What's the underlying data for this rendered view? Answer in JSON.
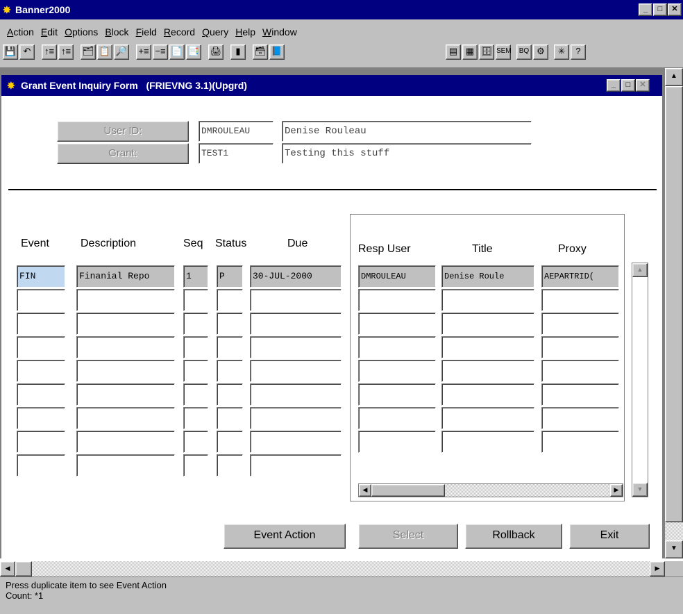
{
  "app": {
    "title": "Banner2000",
    "icon": "banner-logo-icon"
  },
  "menu": [
    "Action",
    "Edit",
    "Options",
    "Block",
    "Field",
    "Record",
    "Query",
    "Help",
    "Window"
  ],
  "toolbar": {
    "left": [
      {
        "name": "save-icon",
        "glyph": "💾"
      },
      {
        "name": "undo-icon",
        "glyph": "↶"
      },
      {
        "name": "previous-block-icon",
        "glyph": "↑≡"
      },
      {
        "name": "next-block-icon",
        "glyph": "↑≡"
      },
      {
        "name": "query-icon",
        "glyph": "🗂"
      },
      {
        "name": "list-icon",
        "glyph": "📋"
      },
      {
        "name": "search-icon",
        "glyph": "🔎"
      },
      {
        "name": "insert-record-icon",
        "glyph": "+≡"
      },
      {
        "name": "remove-record-icon",
        "glyph": "−≡"
      },
      {
        "name": "copy-icon",
        "glyph": "📄"
      },
      {
        "name": "paste-icon",
        "glyph": "📑"
      },
      {
        "name": "print-icon",
        "glyph": "🖨"
      },
      {
        "name": "chart-icon",
        "glyph": "▮"
      },
      {
        "name": "form-icon",
        "glyph": "🗃"
      },
      {
        "name": "help-book-icon",
        "glyph": "📘"
      }
    ],
    "right": [
      {
        "name": "calculator-icon",
        "glyph": "▤"
      },
      {
        "name": "calendar-icon",
        "glyph": "▦"
      },
      {
        "name": "organizer-icon",
        "glyph": "🗄"
      },
      {
        "name": "sem-icon",
        "glyph": "SEM"
      },
      {
        "name": "bq-icon",
        "glyph": "BQ"
      },
      {
        "name": "refresh-icon",
        "glyph": "⚙"
      },
      {
        "name": "options-icon",
        "glyph": "✳"
      },
      {
        "name": "help-icon",
        "glyph": "?"
      }
    ]
  },
  "form": {
    "title": "Grant Event Inquiry Form   (FRIEVNG 3.1)(Upgrd)",
    "user_label": "User ID:",
    "user_id": "DMROULEAU",
    "user_name": "Denise Rouleau",
    "grant_label": "Grant:",
    "grant_code": "TEST1",
    "grant_desc": "Testing this stuff"
  },
  "events": {
    "headers": {
      "event": "Event",
      "description": "Description",
      "seq": "Seq",
      "status": "Status",
      "due": "Due"
    },
    "rows": [
      {
        "event": "FIN",
        "description": "Finanial Repo",
        "seq": "1",
        "status": "P",
        "due": "30-JUL-2000"
      },
      {
        "event": "",
        "description": "",
        "seq": "",
        "status": "",
        "due": ""
      },
      {
        "event": "",
        "description": "",
        "seq": "",
        "status": "",
        "due": ""
      },
      {
        "event": "",
        "description": "",
        "seq": "",
        "status": "",
        "due": ""
      },
      {
        "event": "",
        "description": "",
        "seq": "",
        "status": "",
        "due": ""
      },
      {
        "event": "",
        "description": "",
        "seq": "",
        "status": "",
        "due": ""
      },
      {
        "event": "",
        "description": "",
        "seq": "",
        "status": "",
        "due": ""
      },
      {
        "event": "",
        "description": "",
        "seq": "",
        "status": "",
        "due": ""
      },
      {
        "event": "",
        "description": "",
        "seq": "",
        "status": "",
        "due": ""
      }
    ]
  },
  "responsible": {
    "headers": {
      "user": "Resp User",
      "title": "Title",
      "proxy": "Proxy"
    },
    "rows": [
      {
        "user": "DMROULEAU",
        "title": "Denise Roule",
        "proxy": "AEPARTRID("
      },
      {
        "user": "",
        "title": "",
        "proxy": ""
      },
      {
        "user": "",
        "title": "",
        "proxy": ""
      },
      {
        "user": "",
        "title": "",
        "proxy": ""
      },
      {
        "user": "",
        "title": "",
        "proxy": ""
      },
      {
        "user": "",
        "title": "",
        "proxy": ""
      },
      {
        "user": "",
        "title": "",
        "proxy": ""
      },
      {
        "user": "",
        "title": "",
        "proxy": ""
      }
    ]
  },
  "buttons": {
    "event_action": "Event Action",
    "select": "Select",
    "rollback": "Rollback",
    "exit": "Exit"
  },
  "status_bar": {
    "line1": "Press duplicate item to see Event Action",
    "line2": "Count: *1"
  }
}
